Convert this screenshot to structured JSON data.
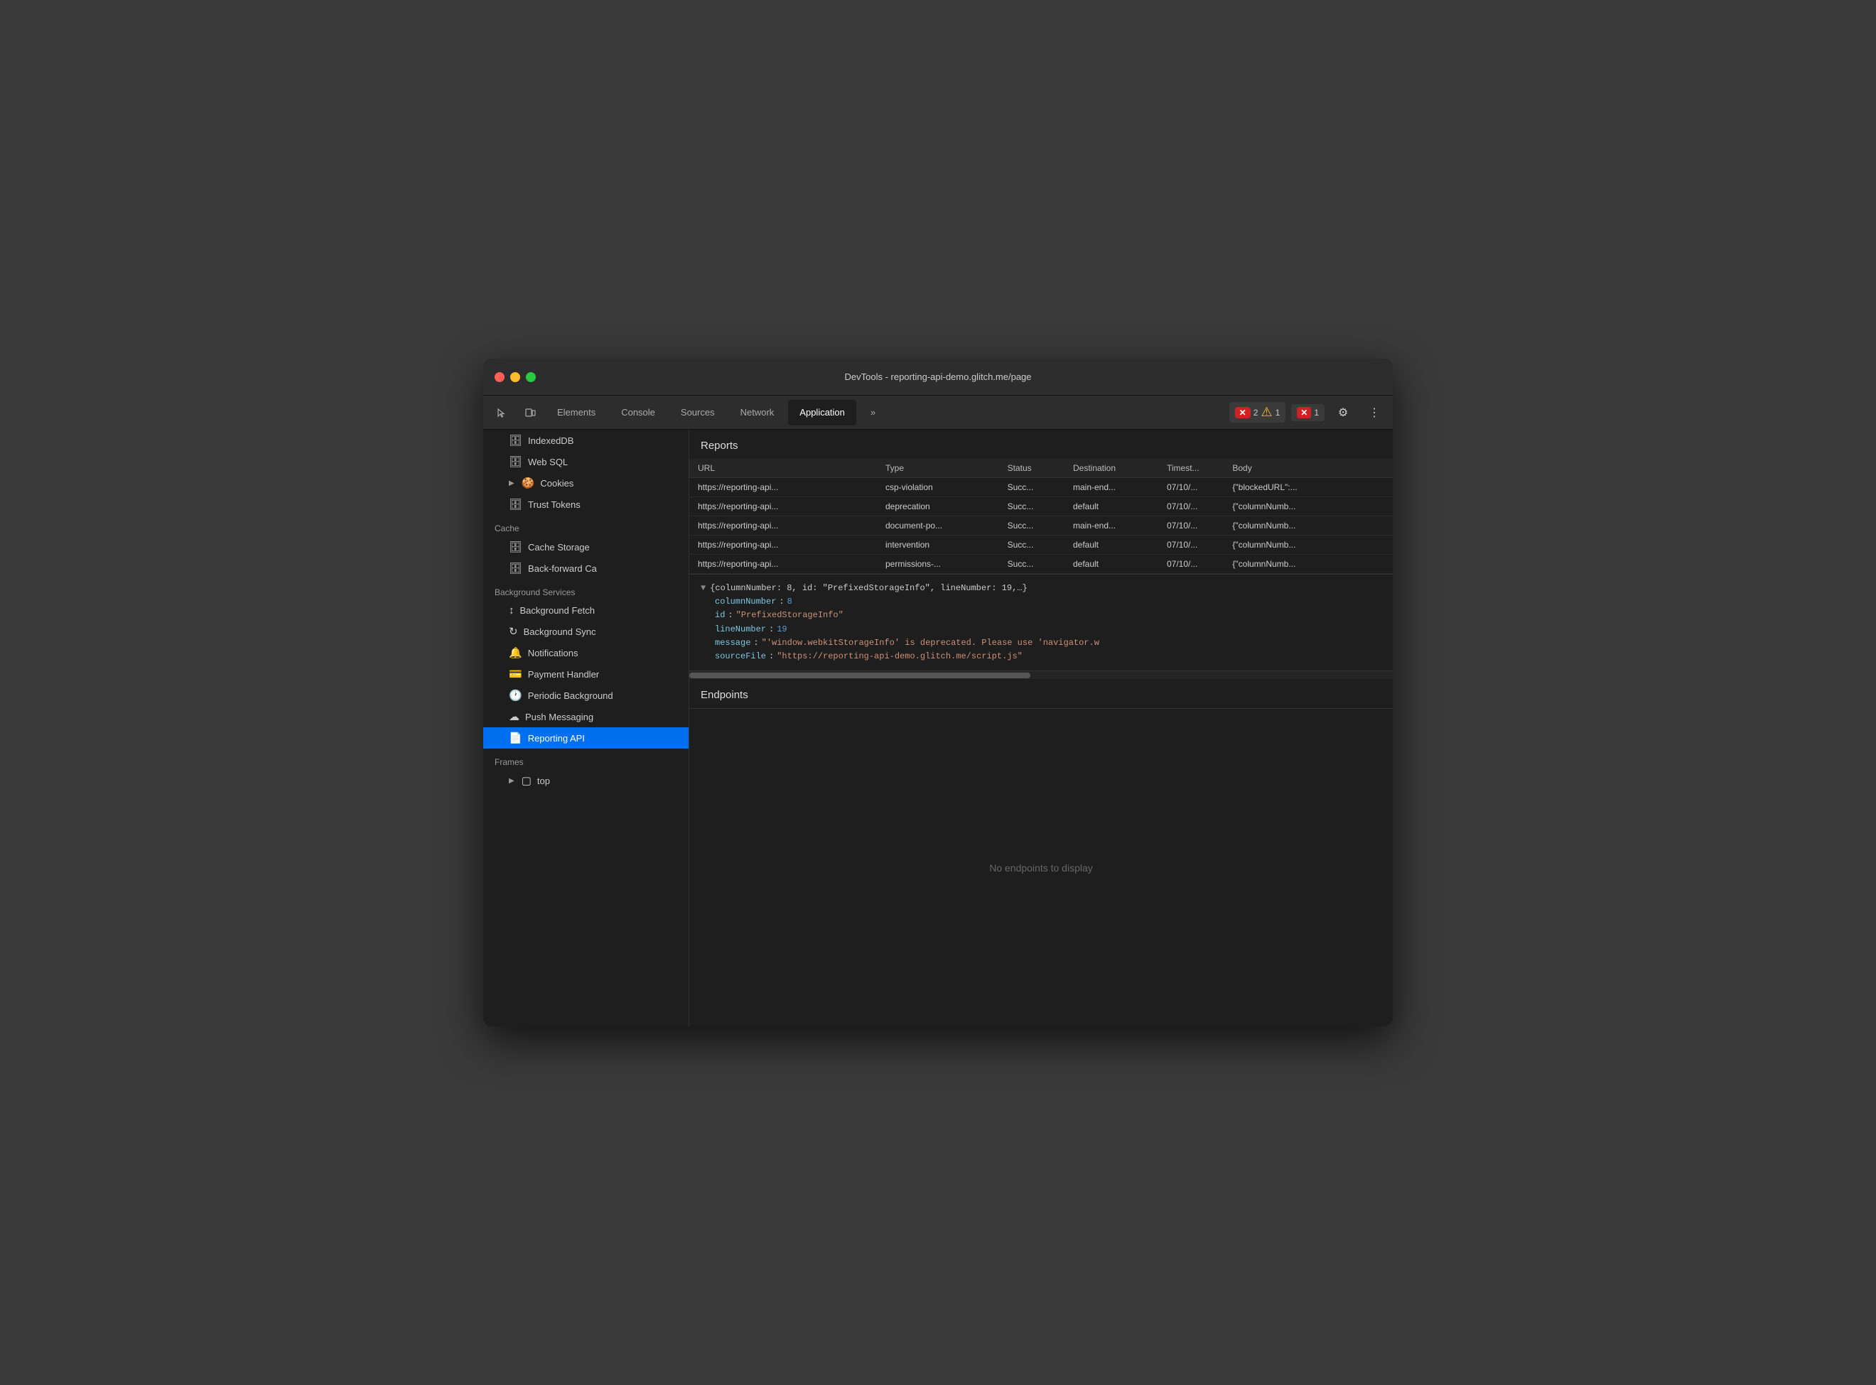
{
  "window": {
    "title": "DevTools - reporting-api-demo.glitch.me/page"
  },
  "toolbar": {
    "tabs": [
      {
        "id": "elements",
        "label": "Elements",
        "active": false
      },
      {
        "id": "console",
        "label": "Console",
        "active": false
      },
      {
        "id": "sources",
        "label": "Sources",
        "active": false
      },
      {
        "id": "network",
        "label": "Network",
        "active": false
      },
      {
        "id": "application",
        "label": "Application",
        "active": true
      }
    ],
    "more_label": "»",
    "error_count": "2",
    "warning_count": "1",
    "error2_count": "1",
    "settings_icon": "⚙",
    "more_icon": "⋮"
  },
  "sidebar": {
    "sections": [
      {
        "items": [
          {
            "id": "indexeddb",
            "icon": "🗄",
            "label": "IndexedDB",
            "indent": 1
          },
          {
            "id": "websql",
            "icon": "🗄",
            "label": "Web SQL",
            "indent": 1
          },
          {
            "id": "cookies",
            "icon": "🍪",
            "label": "Cookies",
            "indent": 1,
            "expandable": true
          },
          {
            "id": "trust-tokens",
            "icon": "🗄",
            "label": "Trust Tokens",
            "indent": 1
          }
        ]
      },
      {
        "title": "Cache",
        "items": [
          {
            "id": "cache-storage",
            "icon": "🗄",
            "label": "Cache Storage",
            "indent": 1
          },
          {
            "id": "back-forward",
            "icon": "🗄",
            "label": "Back-forward Ca",
            "indent": 1
          }
        ]
      },
      {
        "title": "Background Services",
        "items": [
          {
            "id": "bg-fetch",
            "icon": "↕",
            "label": "Background Fetch",
            "indent": 1
          },
          {
            "id": "bg-sync",
            "icon": "↻",
            "label": "Background Sync",
            "indent": 1
          },
          {
            "id": "notifications",
            "icon": "🔔",
            "label": "Notifications",
            "indent": 1
          },
          {
            "id": "payment-handler",
            "icon": "💳",
            "label": "Payment Handler",
            "indent": 1
          },
          {
            "id": "periodic-bg",
            "icon": "🕐",
            "label": "Periodic Background",
            "indent": 1
          },
          {
            "id": "push-messaging",
            "icon": "☁",
            "label": "Push Messaging",
            "indent": 1
          },
          {
            "id": "reporting-api",
            "icon": "📄",
            "label": "Reporting API",
            "indent": 1,
            "active": true
          }
        ]
      },
      {
        "title": "Frames",
        "items": [
          {
            "id": "frames-top",
            "icon": "▢",
            "label": "top",
            "indent": 1,
            "expandable": true
          }
        ]
      }
    ]
  },
  "reports": {
    "title": "Reports",
    "columns": [
      "URL",
      "Type",
      "Status",
      "Destination",
      "Timest...",
      "Body"
    ],
    "rows": [
      {
        "url": "https://reporting-api...",
        "type": "csp-violation",
        "status": "Succ...",
        "destination": "main-end...",
        "timestamp": "07/10/...",
        "body": "{\"blockedURL\":..."
      },
      {
        "url": "https://reporting-api...",
        "type": "deprecation",
        "status": "Succ...",
        "destination": "default",
        "timestamp": "07/10/...",
        "body": "{\"columnNumb..."
      },
      {
        "url": "https://reporting-api...",
        "type": "document-po...",
        "status": "Succ...",
        "destination": "main-end...",
        "timestamp": "07/10/...",
        "body": "{\"columnNumb..."
      },
      {
        "url": "https://reporting-api...",
        "type": "intervention",
        "status": "Succ...",
        "destination": "default",
        "timestamp": "07/10/...",
        "body": "{\"columnNumb..."
      },
      {
        "url": "https://reporting-api...",
        "type": "permissions-...",
        "status": "Succ...",
        "destination": "default",
        "timestamp": "07/10/...",
        "body": "{\"columnNumb..."
      }
    ]
  },
  "json_detail": {
    "summary": "{columnNumber: 8, id: \"PrefixedStorageInfo\", lineNumber: 19,…}",
    "fields": [
      {
        "key": "columnNumber",
        "value": "8",
        "type": "num"
      },
      {
        "key": "id",
        "value": "\"PrefixedStorageInfo\"",
        "type": "str"
      },
      {
        "key": "lineNumber",
        "value": "19",
        "type": "num"
      },
      {
        "key": "message",
        "value": "\"'window.webkitStorageInfo' is deprecated. Please use 'navigator.w",
        "type": "str"
      },
      {
        "key": "sourceFile",
        "value": "\"https://reporting-api-demo.glitch.me/script.js\"",
        "type": "str"
      }
    ]
  },
  "endpoints": {
    "title": "Endpoints",
    "empty_message": "No endpoints to display"
  }
}
